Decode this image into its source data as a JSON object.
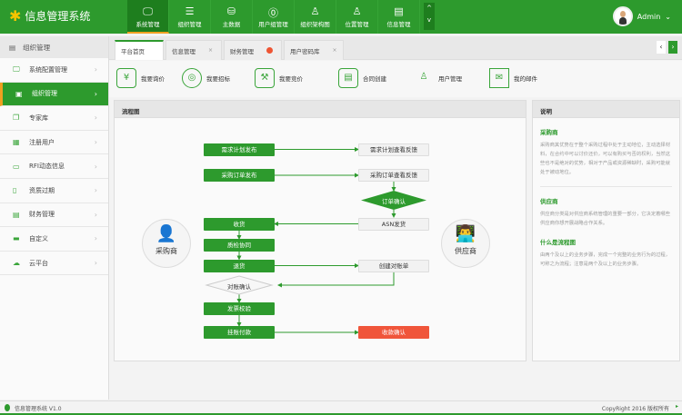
{
  "app": {
    "title": "信息管理系统",
    "user": "Admin"
  },
  "nav": [
    {
      "label": "系统管理",
      "icon": "monitor-icon"
    },
    {
      "label": "组织管理",
      "icon": "list-icon"
    },
    {
      "label": "主数据",
      "icon": "database-icon"
    },
    {
      "label": "用户组管理",
      "icon": "user-group-icon"
    },
    {
      "label": "组织架构图",
      "icon": "org-chart-icon"
    },
    {
      "label": "位置管理",
      "icon": "location-icon"
    },
    {
      "label": "信息管理",
      "icon": "document-icon"
    }
  ],
  "sidebar": {
    "title": "组织管理",
    "items": [
      {
        "label": "系统配置管理"
      },
      {
        "label": "组织管理"
      },
      {
        "label": "专家库"
      },
      {
        "label": "注册用户"
      },
      {
        "label": "RFI动态信息"
      },
      {
        "label": "资质过期"
      },
      {
        "label": "财务管理"
      },
      {
        "label": "自定义"
      },
      {
        "label": "云平台"
      }
    ]
  },
  "tabs": [
    {
      "label": "平台首页"
    },
    {
      "label": "信息管理"
    },
    {
      "label": "财务管理"
    },
    {
      "label": "用户密码库"
    }
  ],
  "shortcuts": [
    {
      "label": "我要询价",
      "icon": "yen-icon"
    },
    {
      "label": "我要招标",
      "icon": "target-icon"
    },
    {
      "label": "我要竞价",
      "icon": "auction-icon"
    },
    {
      "label": "合同创建",
      "icon": "contract-icon"
    },
    {
      "label": "用户管理",
      "icon": "user-icon"
    },
    {
      "label": "我的邮件",
      "icon": "mail-icon"
    }
  ],
  "flow": {
    "title": "流程图",
    "buyer": "采购商",
    "supplier": "供应商",
    "left": [
      "需求计划发布",
      "采购订单发布",
      "收货",
      "质检协同",
      "退货",
      "发票校验",
      "挂账付款"
    ],
    "right": [
      "需求计划查看反馈",
      "采购订单查看反馈",
      "ASN发货",
      "创建对账单",
      "收款确认"
    ],
    "order_confirm": "订单确认",
    "reconcile_confirm": "对账确认"
  },
  "desc": {
    "title": "说明",
    "sections": [
      {
        "h": "采购商",
        "p": "采购商其优势在于整个采购过程中处于主动地位，主动选择材料，在合约中可以讨价还价，可以有购买与否的权利，当然这些也不是绝对的优势，相对于产品或资源稀缺时，采购可能就处于被动地位。"
      },
      {
        "h": "供应商",
        "p": "供应商分类是对供应商系统管理的重要一部分，它决定着哪些供应商你想开展战略合作关系。"
      },
      {
        "h": "什么是流程图",
        "p": "由两个及以上的业务步骤，完成一个完整的业务行为的过程，可称之为流程；注意是两个及以上的业务步骤。"
      }
    ]
  },
  "footer": {
    "left": "信息管理系统 V1.0",
    "right": "CopyRight 2016  版权所有"
  }
}
